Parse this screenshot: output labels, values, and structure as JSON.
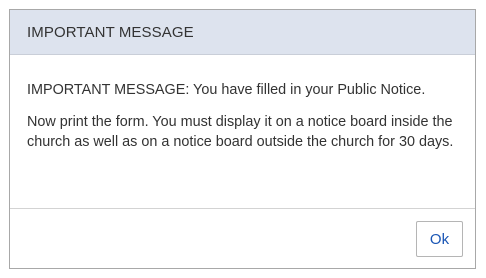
{
  "dialog": {
    "title": "IMPORTANT MESSAGE",
    "message_line1": "IMPORTANT MESSAGE: You have filled in your Public Notice.",
    "message_line2": "Now print the form. You must display it on a notice board inside the church as well as on a notice board outside the church for 30 days.",
    "ok_label": "Ok"
  },
  "colors": {
    "header_background": "#dde3ee",
    "button_text": "#1a56b5",
    "text": "#333333"
  }
}
